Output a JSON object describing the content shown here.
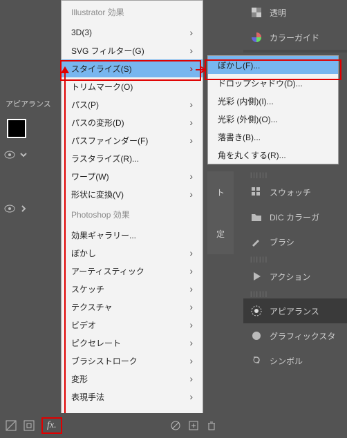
{
  "leftPanel": {
    "title": "アピアランス"
  },
  "menu1": {
    "sectionA": "Illustrator 効果",
    "sectionB": "Photoshop 効果",
    "items1": [
      {
        "label": "3D(3)",
        "sub": true
      },
      {
        "label": "SVG フィルター(G)",
        "sub": true
      },
      {
        "label": "スタイライズ(S)",
        "sub": true,
        "hi": true
      },
      {
        "label": "トリムマーク(O)",
        "sub": false
      },
      {
        "label": "パス(P)",
        "sub": true
      },
      {
        "label": "パスの変形(D)",
        "sub": true
      },
      {
        "label": "パスファインダー(F)",
        "sub": true
      },
      {
        "label": "ラスタライズ(R)...",
        "sub": false
      },
      {
        "label": "ワープ(W)",
        "sub": true
      },
      {
        "label": "形状に変換(V)",
        "sub": true
      }
    ],
    "items2": [
      {
        "label": "効果ギャラリー...",
        "sub": false
      },
      {
        "label": "ぼかし",
        "sub": true
      },
      {
        "label": "アーティスティック",
        "sub": true
      },
      {
        "label": "スケッチ",
        "sub": true
      },
      {
        "label": "テクスチャ",
        "sub": true
      },
      {
        "label": "ビデオ",
        "sub": true
      },
      {
        "label": "ピクセレート",
        "sub": true
      },
      {
        "label": "ブラシストローク",
        "sub": true
      },
      {
        "label": "変形",
        "sub": true
      },
      {
        "label": "表現手法",
        "sub": true
      }
    ]
  },
  "menu2": {
    "items": [
      {
        "label": "ぼかし(F)...",
        "hi": true
      },
      {
        "label": "ドロップシャドウ(D)..."
      },
      {
        "label": "光彩 (内側)(I)..."
      },
      {
        "label": "光彩 (外側)(O)..."
      },
      {
        "label": "落書き(B)..."
      },
      {
        "label": "角を丸くする(R)..."
      }
    ]
  },
  "rightPanel": {
    "items": [
      {
        "label": "透明",
        "icon": "transparency"
      },
      {
        "label": "カラーガイド",
        "icon": "color-guide"
      },
      {
        "label": "スウォッチ",
        "icon": "swatch"
      },
      {
        "label": "DIC カラーガ",
        "icon": "folder"
      },
      {
        "label": "ブラシ",
        "icon": "brush"
      },
      {
        "label": "アクション",
        "icon": "play"
      },
      {
        "label": "アピアランス",
        "icon": "appearance",
        "active": true
      },
      {
        "label": "グラフィックスタ",
        "icon": "graphic-style"
      },
      {
        "label": "シンボル",
        "icon": "symbol"
      }
    ]
  },
  "rightStrip": {
    "a": "ト",
    "b": "定"
  },
  "fx": {
    "label": "fx."
  }
}
